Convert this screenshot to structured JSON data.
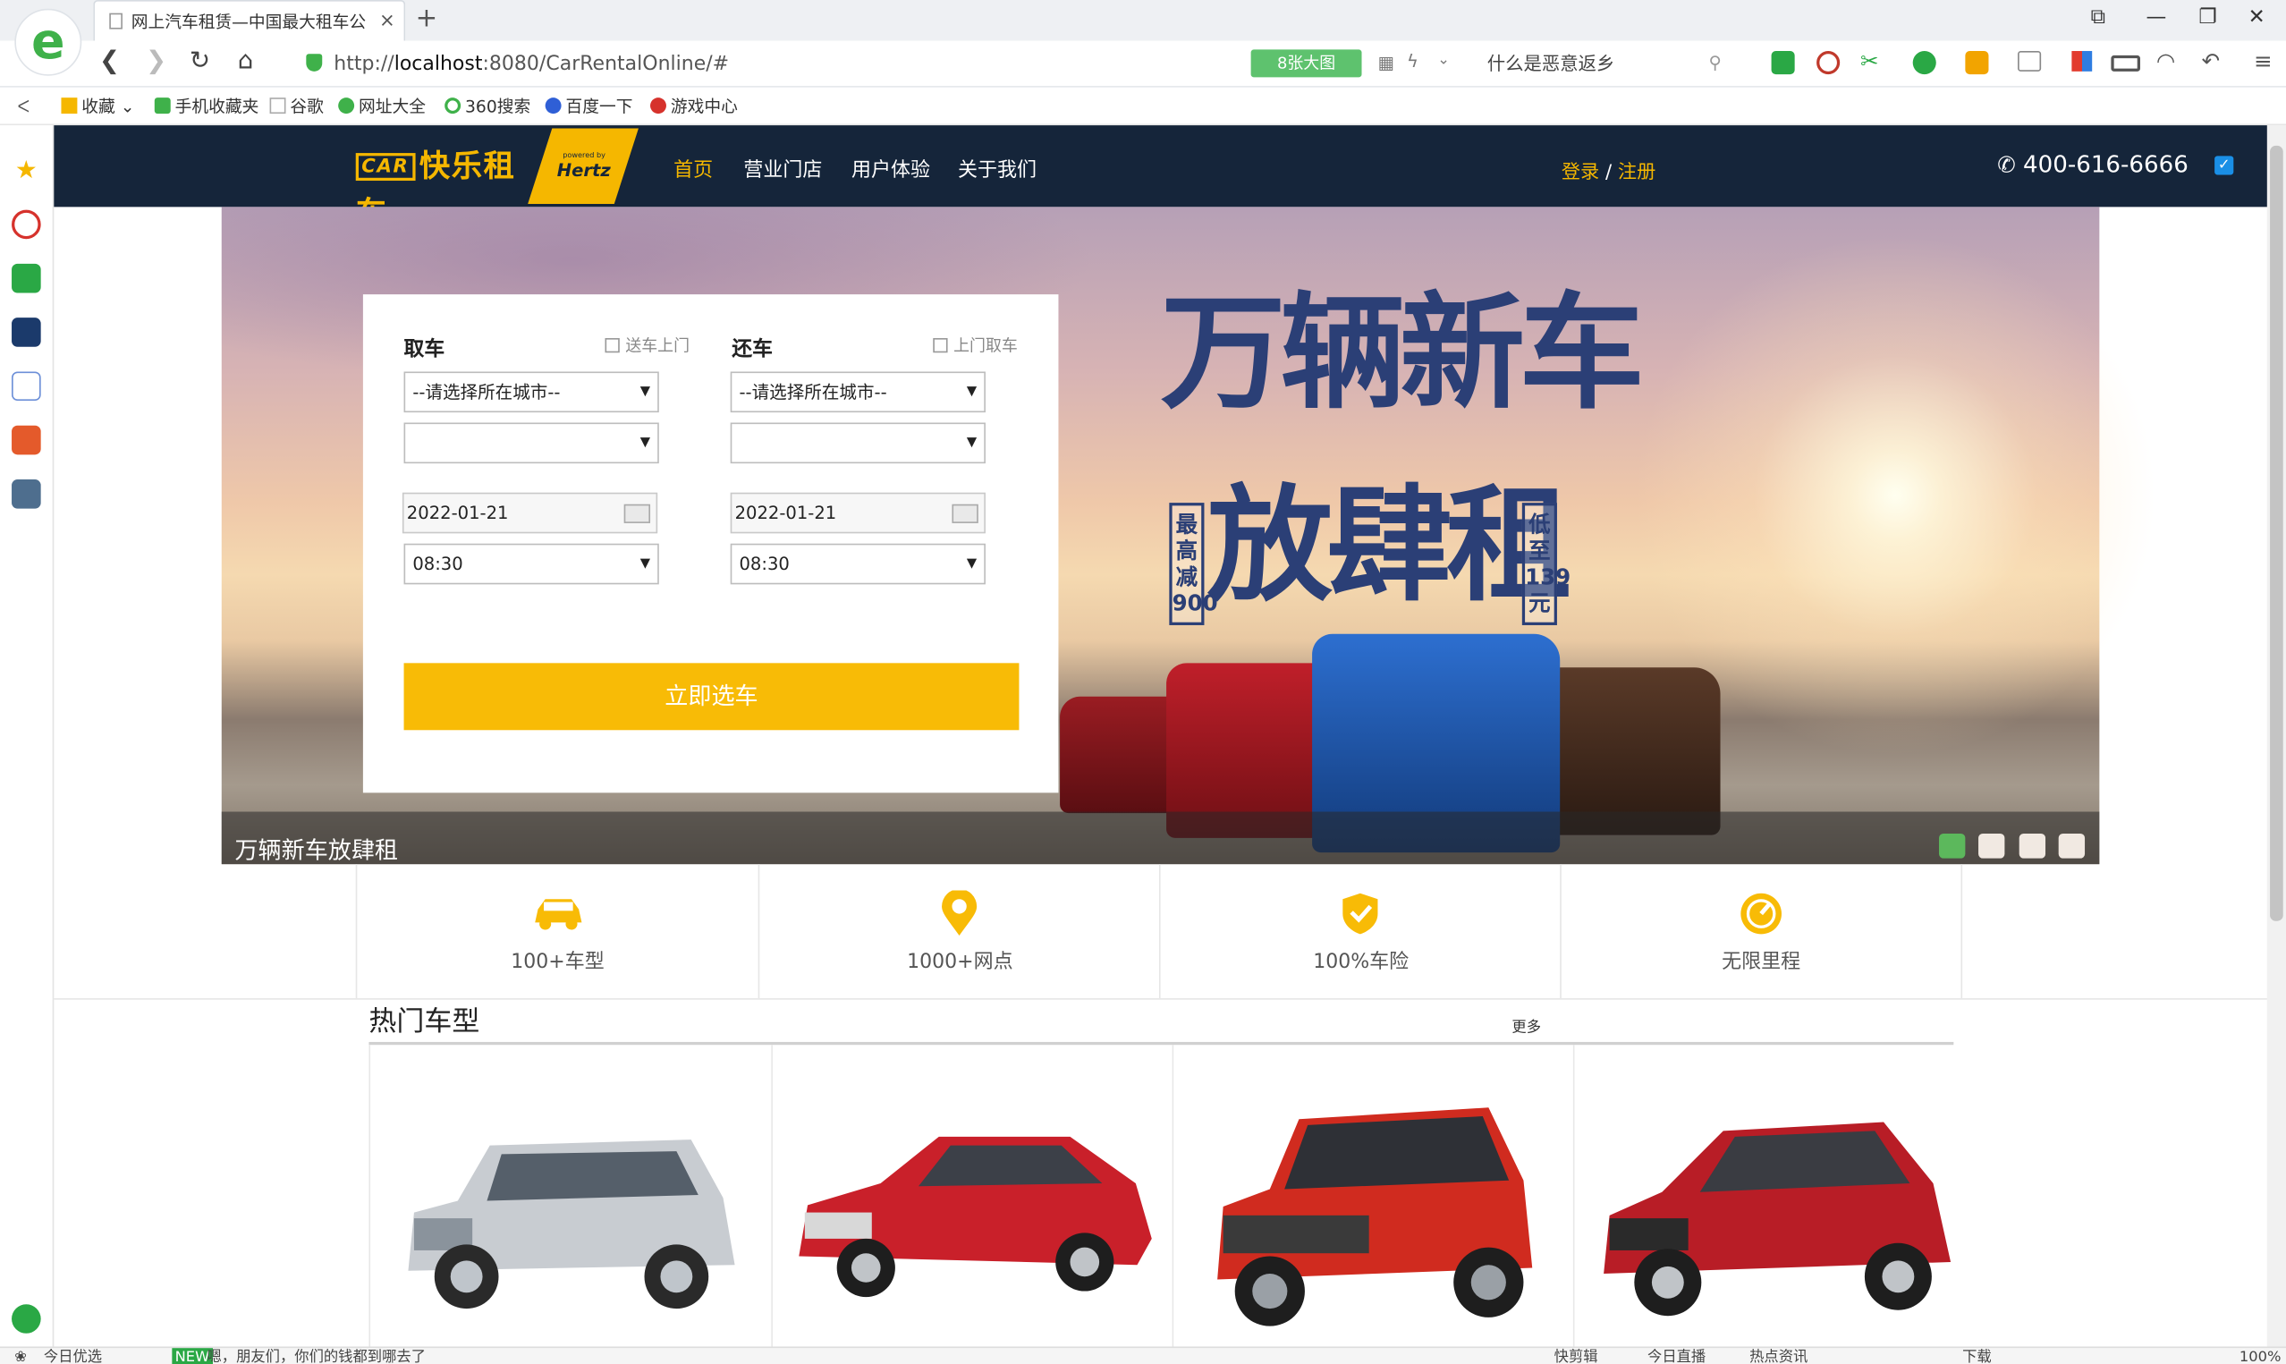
{
  "browser": {
    "tab_title": "网上汽车租赁—中国最大租车公",
    "tab_close": "×",
    "new_tab": "+",
    "url_prefix": "http://",
    "url_host": "localhost",
    "url_rest": ":8080/CarRentalOnline/#",
    "image_badge": "8张大图",
    "search_text": "什么是恶意返乡",
    "window_controls": [
      "⧉",
      "—",
      "❐",
      "✕"
    ],
    "nav_icons": [
      "back-icon",
      "forward-icon",
      "reload-icon",
      "home-icon"
    ],
    "bookmarks": [
      "收藏",
      "手机收藏夹",
      "谷歌",
      "网址大全",
      "360搜索",
      "百度一下",
      "游戏中心"
    ],
    "status_left": "今日优选",
    "status_news": "嗯，朋友们，你们的钱都到哪去了",
    "status_right": [
      "快剪辑",
      "今日直播",
      "热点资讯",
      "下载",
      "100%"
    ]
  },
  "site": {
    "brand_car": "CAR",
    "brand_name": "快乐租车",
    "brand_partner": "Hertz",
    "brand_powered": "powered by",
    "nav": [
      "首页",
      "营业门店",
      "用户体验",
      "关于我们"
    ],
    "login": "登录",
    "login_sep": " / ",
    "register": "注册",
    "phone": "400-616-6666",
    "accent": "#f5b700",
    "header_bg": "#15253a"
  },
  "banner": {
    "slogan_line1": "万辆新车",
    "slogan_line2": "放肆租",
    "side_left": "最高减900",
    "side_right": "低至139元",
    "caption": "万辆新车放肆租",
    "active_dot_color": "#5cb85c"
  },
  "form": {
    "pickup_label": "取车",
    "pickup_option": "送车上门",
    "return_label": "还车",
    "return_option": "上门取车",
    "city_placeholder": "--请选择所在城市--",
    "pickup_date": "2022-01-21",
    "pickup_time": "08:30",
    "return_date": "2022-01-21",
    "return_time": "08:30",
    "submit": "立即选车"
  },
  "features": [
    {
      "icon": "car-icon",
      "label": "100+车型"
    },
    {
      "icon": "location-pin-icon",
      "label": "1000+网点"
    },
    {
      "icon": "shield-check-icon",
      "label": "100%车险"
    },
    {
      "icon": "speedometer-icon",
      "label": "无限里程"
    }
  ],
  "hot": {
    "title": "热门车型",
    "more": "更多"
  }
}
